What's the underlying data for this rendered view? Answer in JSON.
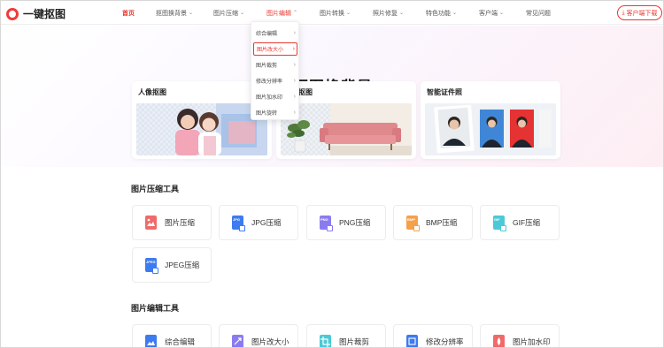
{
  "header": {
    "logo_text": "一键抠图",
    "nav": [
      {
        "label": "首页",
        "chevron": false
      },
      {
        "label": "抠图换背景",
        "chevron": true
      },
      {
        "label": "图片压缩",
        "chevron": true
      },
      {
        "label": "图片编辑",
        "chevron": true
      },
      {
        "label": "图片转换",
        "chevron": true
      },
      {
        "label": "照片修复",
        "chevron": true
      },
      {
        "label": "特色功能",
        "chevron": true
      },
      {
        "label": "客户端",
        "chevron": true
      },
      {
        "label": "常见问题",
        "chevron": false
      }
    ],
    "download_label": "客户端下载"
  },
  "dropdown": {
    "items": [
      "综合编辑",
      "图片改大小",
      "图片裁剪",
      "修改分辨率",
      "图片加水印",
      "图片旋转"
    ],
    "selected_index": 1
  },
  "hero": {
    "title": "抠图换背景",
    "cards": [
      {
        "title": "人像抠图"
      },
      {
        "title": "抠图"
      },
      {
        "title": "智能证件照"
      }
    ]
  },
  "compress_section": {
    "title": "图片压缩工具",
    "tools": [
      {
        "label": "图片压缩",
        "icon": "image-compress-icon",
        "badge": "",
        "color": "#f06a6a"
      },
      {
        "label": "JPG压缩",
        "icon": "jpg-file-icon",
        "badge": "JPG",
        "color": "#3d7bf0"
      },
      {
        "label": "PNG压缩",
        "icon": "png-file-icon",
        "badge": "PNG",
        "color": "#8a7cf0"
      },
      {
        "label": "BMP压缩",
        "icon": "bmp-file-icon",
        "badge": "BMP",
        "color": "#f5a04a"
      },
      {
        "label": "GIF压缩",
        "icon": "gif-file-icon",
        "badge": "GIF",
        "color": "#4cc9d6"
      },
      {
        "label": "JPEG压缩",
        "icon": "jpeg-file-icon",
        "badge": "JPEG",
        "color": "#3d7bf0"
      }
    ]
  },
  "edit_section": {
    "title": "图片编辑工具",
    "tools": [
      {
        "label": "综合编辑",
        "icon": "comprehensive-edit-icon",
        "color": "#3d7bf0"
      },
      {
        "label": "图片改大小",
        "icon": "resize-icon",
        "color": "#8a7cf0"
      },
      {
        "label": "图片裁剪",
        "icon": "crop-icon",
        "color": "#4cc9d6"
      },
      {
        "label": "修改分辨率",
        "icon": "resolution-icon",
        "color": "#3d7bf0"
      },
      {
        "label": "图片加水印",
        "icon": "watermark-icon",
        "color": "#f06a6a"
      }
    ]
  }
}
